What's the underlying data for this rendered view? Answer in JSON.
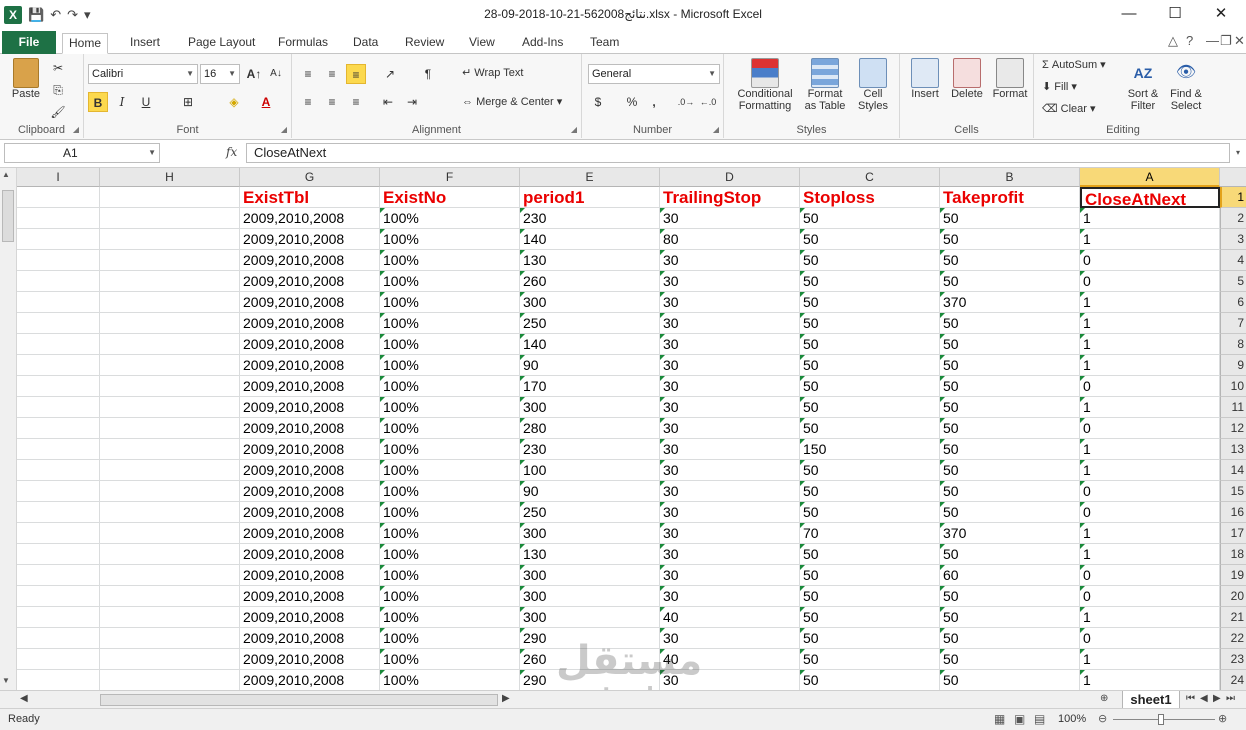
{
  "window": {
    "title": "28-09-2018-10-21-56نتائج2008.xlsx  -  Microsoft Excel",
    "minimize": "—",
    "maximize": "☐",
    "close": "✕"
  },
  "tabs": [
    "File",
    "Home",
    "Insert",
    "Page Layout",
    "Formulas",
    "Data",
    "Review",
    "View",
    "Add-Ins",
    "Team"
  ],
  "active_tab": "Home",
  "ribbon": {
    "clipboard": {
      "label": "Clipboard",
      "paste": "Paste"
    },
    "font": {
      "label": "Font",
      "name": "Calibri",
      "size": "16",
      "bold": "B",
      "italic": "I",
      "underline": "U"
    },
    "alignment": {
      "label": "Alignment",
      "wrap_text": "Wrap Text",
      "merge_center": "Merge & Center"
    },
    "number": {
      "label": "Number",
      "format": "General",
      "currency": "$",
      "percent": "%",
      "comma": ","
    },
    "styles": {
      "label": "Styles",
      "conditional": "Conditional",
      "conditional2": "Formatting",
      "format_table": "Format",
      "format_table2": "as Table",
      "cell_styles": "Cell",
      "cell_styles2": "Styles"
    },
    "cells": {
      "label": "Cells",
      "insert": "Insert",
      "delete": "Delete",
      "format": "Format"
    },
    "editing": {
      "label": "Editing",
      "autosum": "AutoSum",
      "fill": "Fill",
      "clear": "Clear",
      "sort": "Sort &",
      "sort2": "Filter",
      "find": "Find &",
      "find2": "Select"
    }
  },
  "formula_bar": {
    "name_box": "A1",
    "fx": "fx",
    "value": "CloseAtNext"
  },
  "columns": [
    "I",
    "H",
    "G",
    "F",
    "E",
    "D",
    "C",
    "B",
    "A"
  ],
  "headers": {
    "G": "ExistTbl",
    "F": "ExistNo",
    "E": "period1",
    "D": "TrailingStop",
    "C": "Stoploss",
    "B": "Takeprofit",
    "A": "CloseAtNext"
  },
  "rows": [
    {
      "n": "2",
      "G": "2009,2010,2008",
      "F": "100%",
      "E": "230",
      "D": "30",
      "C": "50",
      "B": "50",
      "A": "1"
    },
    {
      "n": "3",
      "G": "2009,2010,2008",
      "F": "100%",
      "E": "140",
      "D": "80",
      "C": "50",
      "B": "50",
      "A": "1"
    },
    {
      "n": "4",
      "G": "2009,2010,2008",
      "F": "100%",
      "E": "130",
      "D": "30",
      "C": "50",
      "B": "50",
      "A": "0"
    },
    {
      "n": "5",
      "G": "2009,2010,2008",
      "F": "100%",
      "E": "260",
      "D": "30",
      "C": "50",
      "B": "50",
      "A": "0"
    },
    {
      "n": "6",
      "G": "2009,2010,2008",
      "F": "100%",
      "E": "300",
      "D": "30",
      "C": "50",
      "B": "370",
      "A": "1"
    },
    {
      "n": "7",
      "G": "2009,2010,2008",
      "F": "100%",
      "E": "250",
      "D": "30",
      "C": "50",
      "B": "50",
      "A": "1"
    },
    {
      "n": "8",
      "G": "2009,2010,2008",
      "F": "100%",
      "E": "140",
      "D": "30",
      "C": "50",
      "B": "50",
      "A": "1"
    },
    {
      "n": "9",
      "G": "2009,2010,2008",
      "F": "100%",
      "E": "90",
      "D": "30",
      "C": "50",
      "B": "50",
      "A": "1"
    },
    {
      "n": "10",
      "G": "2009,2010,2008",
      "F": "100%",
      "E": "170",
      "D": "30",
      "C": "50",
      "B": "50",
      "A": "0"
    },
    {
      "n": "11",
      "G": "2009,2010,2008",
      "F": "100%",
      "E": "300",
      "D": "30",
      "C": "50",
      "B": "50",
      "A": "1"
    },
    {
      "n": "12",
      "G": "2009,2010,2008",
      "F": "100%",
      "E": "280",
      "D": "30",
      "C": "50",
      "B": "50",
      "A": "0"
    },
    {
      "n": "13",
      "G": "2009,2010,2008",
      "F": "100%",
      "E": "230",
      "D": "30",
      "C": "150",
      "B": "50",
      "A": "1"
    },
    {
      "n": "14",
      "G": "2009,2010,2008",
      "F": "100%",
      "E": "100",
      "D": "30",
      "C": "50",
      "B": "50",
      "A": "1"
    },
    {
      "n": "15",
      "G": "2009,2010,2008",
      "F": "100%",
      "E": "90",
      "D": "30",
      "C": "50",
      "B": "50",
      "A": "0"
    },
    {
      "n": "16",
      "G": "2009,2010,2008",
      "F": "100%",
      "E": "250",
      "D": "30",
      "C": "50",
      "B": "50",
      "A": "0"
    },
    {
      "n": "17",
      "G": "2009,2010,2008",
      "F": "100%",
      "E": "300",
      "D": "30",
      "C": "70",
      "B": "370",
      "A": "1"
    },
    {
      "n": "18",
      "G": "2009,2010,2008",
      "F": "100%",
      "E": "130",
      "D": "30",
      "C": "50",
      "B": "50",
      "A": "1"
    },
    {
      "n": "19",
      "G": "2009,2010,2008",
      "F": "100%",
      "E": "300",
      "D": "30",
      "C": "50",
      "B": "60",
      "A": "0"
    },
    {
      "n": "20",
      "G": "2009,2010,2008",
      "F": "100%",
      "E": "300",
      "D": "30",
      "C": "50",
      "B": "50",
      "A": "0"
    },
    {
      "n": "21",
      "G": "2009,2010,2008",
      "F": "100%",
      "E": "300",
      "D": "40",
      "C": "50",
      "B": "50",
      "A": "1"
    },
    {
      "n": "22",
      "G": "2009,2010,2008",
      "F": "100%",
      "E": "290",
      "D": "30",
      "C": "50",
      "B": "50",
      "A": "0"
    },
    {
      "n": "23",
      "G": "2009,2010,2008",
      "F": "100%",
      "E": "260",
      "D": "40",
      "C": "50",
      "B": "50",
      "A": "1"
    },
    {
      "n": "24",
      "G": "2009,2010,2008",
      "F": "100%",
      "E": "290",
      "D": "30",
      "C": "50",
      "B": "50",
      "A": "1"
    }
  ],
  "sheet_tab": "sheet1",
  "status": {
    "ready": "Ready",
    "zoom": "100%"
  },
  "watermark": {
    "top": "مستقل",
    "bottom": "mostaql.com"
  },
  "colors": {
    "header_text": "#ea0000",
    "excel_green": "#1e7145",
    "selection": "#f8d978"
  }
}
